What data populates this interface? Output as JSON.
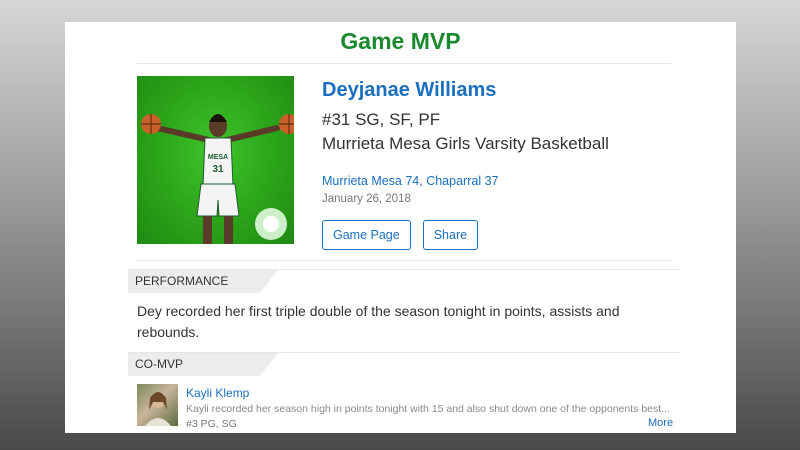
{
  "header": {
    "title": "Game MVP"
  },
  "player": {
    "name": "Deyjanae Williams",
    "number_positions": "#31 SG, SF, PF",
    "team": "Murrieta Mesa Girls Varsity Basketball",
    "jersey_text": "MESA",
    "jersey_number": "31"
  },
  "game": {
    "score": "Murrieta Mesa 74, Chaparral 37",
    "date": "January 26, 2018"
  },
  "buttons": {
    "game_page": "Game Page",
    "share": "Share"
  },
  "performance": {
    "heading": "PERFORMANCE",
    "text": "Dey recorded her first triple double of the season tonight in points, assists and rebounds."
  },
  "comvp": {
    "heading": "CO-MVP",
    "name": "Kayli Klemp",
    "description": "Kayli recorded her season high in points tonight with 15 and also shut down one of the opponents best...",
    "positions": "#3 PG, SG",
    "more_label": "More"
  },
  "colors": {
    "title_green": "#1b8a2e",
    "link_blue": "#1a6fbf",
    "backdrop_green": "#2aa018"
  }
}
